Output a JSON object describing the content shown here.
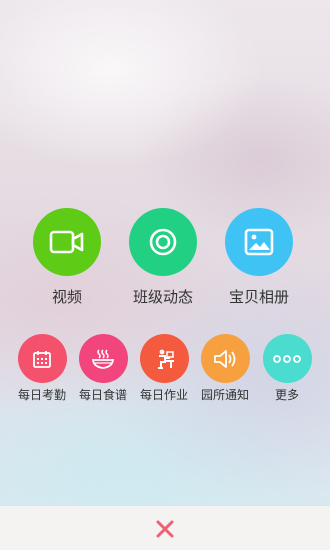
{
  "publish_menu": {
    "primary": [
      {
        "label": "视频",
        "icon": "video-camera-icon",
        "color": "#5ecb17"
      },
      {
        "label": "班级动态",
        "icon": "class-feed-icon",
        "color": "#22d083"
      },
      {
        "label": "宝贝相册",
        "icon": "photo-album-icon",
        "color": "#3fc3f5"
      }
    ],
    "secondary": [
      {
        "label": "每日考勤",
        "icon": "calendar-icon",
        "color": "#f4526c"
      },
      {
        "label": "每日食谱",
        "icon": "food-bowl-icon",
        "color": "#f2457d"
      },
      {
        "label": "每日作业",
        "icon": "homework-desk-icon",
        "color": "#f45a3e"
      },
      {
        "label": "园所通知",
        "icon": "speaker-icon",
        "color": "#f7a03f"
      },
      {
        "label": "更多",
        "icon": "more-dots-icon",
        "color": "#49dccf"
      }
    ]
  },
  "close_button": {
    "icon": "close-icon",
    "color": "#f06070"
  }
}
